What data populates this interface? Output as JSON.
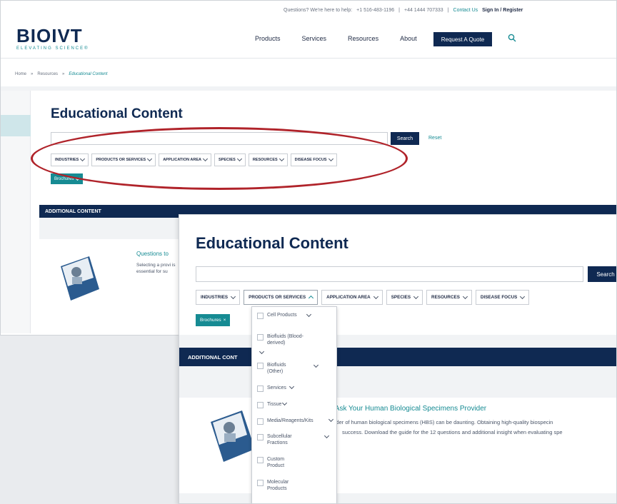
{
  "topbar": {
    "questions": "Questions? We're here to help:",
    "phone_us": "+1 516-483-1196",
    "sep1": "|",
    "phone_uk": "+44 1444 707333",
    "sep2": "|",
    "contact": "Contact Us",
    "signin": "Sign In / Register"
  },
  "logo": {
    "wordmark": "BIOIVT",
    "tagline": "ELEVATING SCIENCE®"
  },
  "nav": {
    "items": [
      "Products",
      "Services",
      "Resources",
      "About"
    ],
    "quote_button": "Request A Quote"
  },
  "breadcrumb": {
    "home": "Home",
    "sep": "»",
    "resources": "Resources",
    "current": "Educational Content"
  },
  "back_page": {
    "title": "Educational Content",
    "search_button": "Search",
    "reset": "Reset",
    "filters": [
      "INDUSTRIES",
      "PRODUCTS OR SERVICES",
      "APPLICATION AREA",
      "SPECIES",
      "RESOURCES",
      "DISEASE FOCUS"
    ],
    "tag": "Brochures",
    "additional": "ADDITIONAL CONTENT",
    "card_title": "Questions to",
    "card_text": "Selecting a provi is essential for su"
  },
  "front_page": {
    "title": "Educational Content",
    "search_button": "Search",
    "filters": [
      "INDUSTRIES",
      "PRODUCTS OR SERVICES",
      "APPLICATION AREA",
      "SPECIES",
      "RESOURCES",
      "DISEASE FOCUS"
    ],
    "tag": "Brochures",
    "tag_close": "×",
    "additional": "ADDITIONAL CONT",
    "card_title": "o Ask Your Human Biological Specimens Provider",
    "card_text_1": "vider of human biological specimens (HBS) can be daunting. Obtaining high-quality biospecin",
    "card_text_2": "success. Download the guide for the 12 questions and additional insight when evaluating spe",
    "dropdown": {
      "items": [
        "Cell Products",
        "Biofluids (Blood-derived)",
        "Biofluids (Other)",
        "Services",
        "Tissue",
        "Media/Reagents/Kits",
        "Subcellular Fractions",
        "Custom Product",
        "Molecular Products"
      ]
    }
  },
  "colors": {
    "navy": "#0f2952",
    "teal": "#168b93",
    "annotation_red": "#b0232a"
  }
}
